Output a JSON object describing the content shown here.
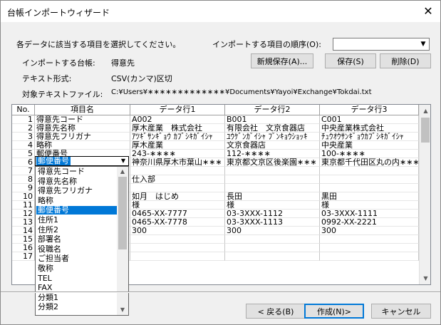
{
  "window": {
    "title": "台帳インポートウィザード",
    "close_glyph": "✕"
  },
  "instructions": "各データに該当する項目を選択してください。",
  "order": {
    "label": "インポートする項目の順序(O):",
    "value": ""
  },
  "info": {
    "ledger_label": "インポートする台帳:",
    "ledger_value": "得意先",
    "format_label": "テキスト形式:",
    "format_value": "CSV(カンマ)区切",
    "file_label": "対象テキストファイル:",
    "file_value": "C:¥Users¥∗∗∗∗∗∗∗∗∗∗∗∗∗¥Documents¥Yayoi¥Exchange¥Tokdai.txt"
  },
  "buttons": {
    "new_save": "新規保存(A)...",
    "save": "保存(S)",
    "delete": "削除(D)",
    "back": "< 戻る(B)",
    "create": "作成(N)>",
    "cancel": "キャンセル"
  },
  "grid": {
    "headers": [
      "No.",
      "項目名",
      "データ行1",
      "データ行2",
      "データ行3"
    ],
    "rows": [
      {
        "no": "1",
        "item": "得意先コード",
        "d1": "A002",
        "d2": "B001",
        "d3": "C001"
      },
      {
        "no": "2",
        "item": "得意先名称",
        "d1": "厚木産業　株式会社",
        "d2": "有限会社　文京食器店",
        "d3": "中央産業株式会社"
      },
      {
        "no": "3",
        "item": "得意先フリガナ",
        "d1": "ｱﾂｷﾞｻﾝｷﾞｮｳ ｶﾌﾞｼｷｶﾞｲｼｬ",
        "d2": "ﾕｳｹﾞﾝｶﾞｲｼｬ ﾌﾞﾝｷｮｳｼｮｯｷ",
        "d3": "ﾁｭｳｵｳｻﾝｷﾞｮｳｶﾌﾞｼｷｶﾞｲｼｬ"
      },
      {
        "no": "4",
        "item": "略称",
        "d1": "厚木産業",
        "d2": "文京食器店",
        "d3": "中央産業"
      },
      {
        "no": "5",
        "item": "郵便番号",
        "d1": "243-∗∗∗∗",
        "d2": "112-∗∗∗∗",
        "d3": "100-∗∗∗∗"
      },
      {
        "no": "6",
        "item": "",
        "d1": "神奈川県厚木市葉山∗∗∗",
        "d2": "東京都文京区後楽園∗∗∗",
        "d3": "東京都千代田区丸の内∗∗∗"
      },
      {
        "no": "7",
        "item": "",
        "d1": "",
        "d2": "",
        "d3": ""
      },
      {
        "no": "8",
        "item": "",
        "d1": "仕入部",
        "d2": "",
        "d3": ""
      },
      {
        "no": "9",
        "item": "",
        "d1": "",
        "d2": "",
        "d3": ""
      },
      {
        "no": "10",
        "item": "",
        "d1": "如月　はじめ",
        "d2": "長田",
        "d3": "黒田"
      },
      {
        "no": "11",
        "item": "",
        "d1": "様",
        "d2": "様",
        "d3": "様"
      },
      {
        "no": "12",
        "item": "",
        "d1": "0465-XX-7777",
        "d2": "03-3XXX-1112",
        "d3": "03-3XXX-1111"
      },
      {
        "no": "13",
        "item": "",
        "d1": "0465-XX-7778",
        "d2": "03-3XXX-1113",
        "d3": "0992-XX-2221"
      },
      {
        "no": "14",
        "item": "",
        "d1": "300",
        "d2": "300",
        "d3": "300"
      },
      {
        "no": "15",
        "item": "",
        "d1": "",
        "d2": "",
        "d3": ""
      },
      {
        "no": "16",
        "item": "",
        "d1": "",
        "d2": "",
        "d3": ""
      },
      {
        "no": "17",
        "item": "",
        "d1": "",
        "d2": "",
        "d3": ""
      }
    ]
  },
  "dropdown": {
    "current": "郵便番号",
    "items": [
      "得意先コード",
      "得意先名称",
      "得意先フリガナ",
      "略称",
      "郵便番号",
      "住所1",
      "住所2",
      "部署名",
      "役職名",
      "ご担当者",
      "敬称",
      "TEL",
      "FAX",
      "分類1",
      "分類2"
    ],
    "selected_index": 4
  },
  "colors": {
    "selection": "#0078d7",
    "default_button_border": "#0078d7"
  }
}
